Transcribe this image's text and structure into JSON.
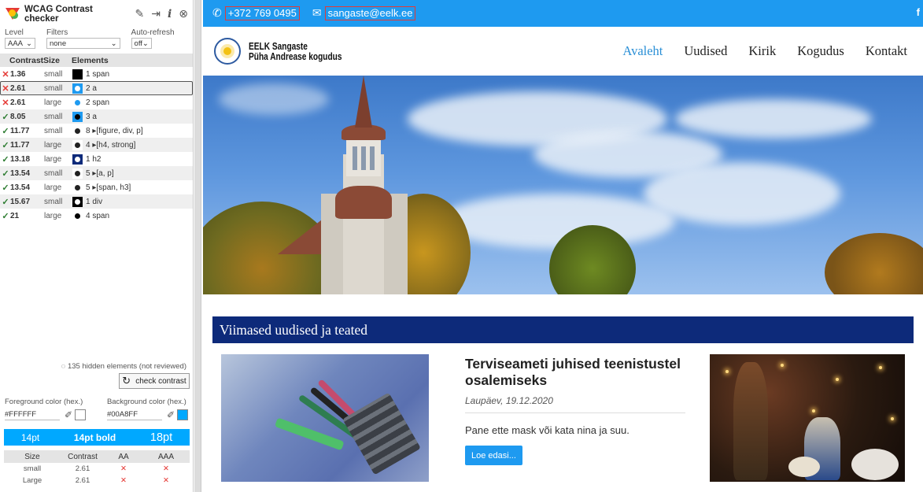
{
  "panel": {
    "title": "WCAG Contrast checker",
    "icons": [
      "pin-icon",
      "dock-icon",
      "info-icon",
      "close-icon"
    ],
    "filters": {
      "level_label": "Level",
      "level_value": "AAA",
      "filters_label": "Filters",
      "filters_value": "none",
      "refresh_label": "Auto-refresh",
      "refresh_value": "off"
    },
    "columns": {
      "contrast": "Contrast",
      "size": "Size",
      "elements": "Elements"
    },
    "rows": [
      {
        "status": "fail",
        "mark": "✕",
        "ratio": "1.36",
        "size": "small",
        "swatch_bg": "#000000",
        "dot": "#000000",
        "elements": "1 span"
      },
      {
        "status": "fail",
        "mark": "✕",
        "ratio": "2.61",
        "size": "small",
        "swatch_bg": "#1e9af0",
        "dot": "#ffffff",
        "elements": "2 a",
        "selected": true
      },
      {
        "status": "fail",
        "mark": "✕",
        "ratio": "2.61",
        "size": "large",
        "swatch_bg": "#ffffff",
        "dot": "#1e9af0",
        "elements": "2 span"
      },
      {
        "status": "pass",
        "mark": "✓",
        "ratio": "8.05",
        "size": "small",
        "swatch_bg": "#1e9af0",
        "dot": "#000000",
        "elements": "3 a"
      },
      {
        "status": "pass",
        "mark": "✓",
        "ratio": "11.77",
        "size": "small",
        "swatch_bg": "#ffffff",
        "dot": "#222222",
        "elements": "8 ▸[figure, div, p]"
      },
      {
        "status": "pass",
        "mark": "✓",
        "ratio": "11.77",
        "size": "large",
        "swatch_bg": "#ffffff",
        "dot": "#222222",
        "elements": "4 ▸[h4, strong]"
      },
      {
        "status": "pass",
        "mark": "✓",
        "ratio": "13.18",
        "size": "large",
        "swatch_bg": "#0d2a7a",
        "dot": "#ffffff",
        "elements": "1 h2"
      },
      {
        "status": "pass",
        "mark": "✓",
        "ratio": "13.54",
        "size": "small",
        "swatch_bg": "#ffffff",
        "dot": "#222222",
        "elements": "5 ▸[a, p]"
      },
      {
        "status": "pass",
        "mark": "✓",
        "ratio": "13.54",
        "size": "large",
        "swatch_bg": "#ffffff",
        "dot": "#222222",
        "elements": "5 ▸[span, h3]"
      },
      {
        "status": "pass",
        "mark": "✓",
        "ratio": "15.67",
        "size": "small",
        "swatch_bg": "#000000",
        "dot": "#ffffff",
        "elements": "1 div"
      },
      {
        "status": "pass",
        "mark": "✓",
        "ratio": "21",
        "size": "large",
        "swatch_bg": "#ffffff",
        "dot": "#000000",
        "elements": "4 span"
      }
    ],
    "hidden_note": "135 hidden elements (not reviewed)",
    "check_button": "check contrast",
    "fg_label": "Foreground color (hex.)",
    "fg_value": "#FFFFFF",
    "fg_color": "#FFFFFF",
    "bg_label": "Background color (hex.)",
    "bg_value": "#00A8FF",
    "bg_color": "#00A8FF",
    "preview": [
      "14pt",
      "14pt bold",
      "18pt"
    ],
    "verdict_cols": [
      "Size",
      "Contrast",
      "AA",
      "AAA"
    ],
    "verdict_rows": [
      {
        "size": "small",
        "contrast": "2.61",
        "aa": "✕",
        "aaa": "✕"
      },
      {
        "size": "Large",
        "contrast": "2.61",
        "aa": "✕",
        "aaa": "✕"
      }
    ]
  },
  "site": {
    "phone": "+372 769 0495",
    "email": "sangaste@eelk.ee",
    "facebook": "f",
    "brand_line1": "EELK Sangaste",
    "brand_line2": "Püha Andrease kogudus",
    "nav": [
      {
        "label": "Avaleht",
        "active": true
      },
      {
        "label": "Uudised"
      },
      {
        "label": "Kirik"
      },
      {
        "label": "Kogudus"
      },
      {
        "label": "Kontakt"
      }
    ],
    "section_title": "Viimased uudised ja teated",
    "news": {
      "headline": "Terviseameti juhised teenistustel osalemiseks",
      "date": "Laupäev, 19.12.2020",
      "summary": "Pane ette mask või kata nina ja suu.",
      "read_more": "Loe edasi..."
    },
    "colors": {
      "topbar": "#1e9af0",
      "nav_active": "#2a8fd6",
      "section": "#0d2a7a"
    }
  }
}
